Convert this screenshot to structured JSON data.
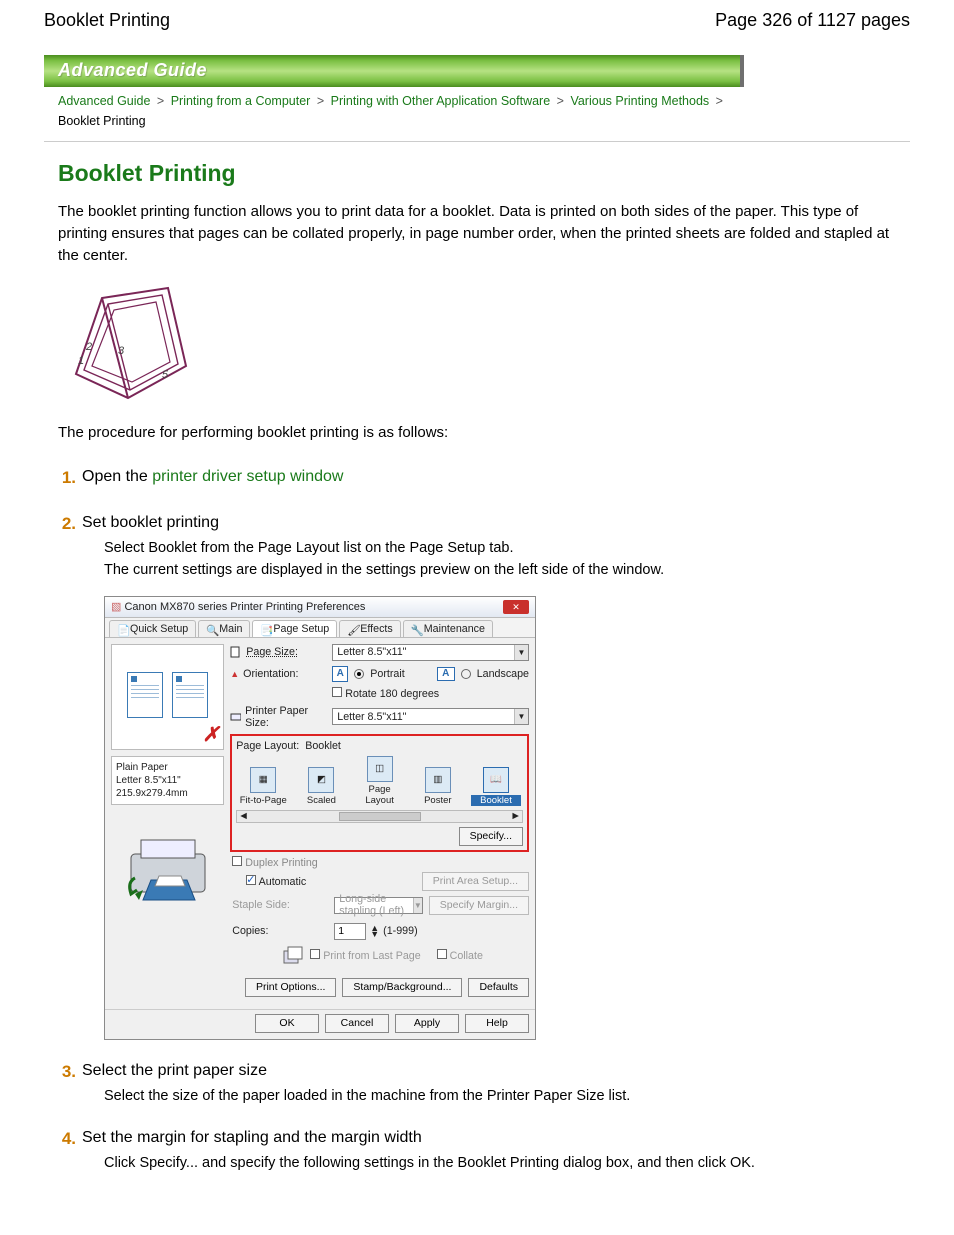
{
  "header": {
    "left": "Booklet Printing",
    "right": "Page 326 of 1127 pages"
  },
  "banner": "Advanced Guide",
  "breadcrumb": {
    "items": [
      {
        "label": "Advanced Guide",
        "link": true
      },
      {
        "label": "Printing from a Computer",
        "link": true
      },
      {
        "label": "Printing with Other Application Software",
        "link": true
      },
      {
        "label": "Various Printing Methods",
        "link": true
      }
    ],
    "last": "Booklet Printing"
  },
  "content": {
    "title": "Booklet Printing",
    "intro": "The booklet printing function allows you to print data for a booklet. Data is printed on both sides of the paper. This type of printing ensures that pages can be collated properly, in page number order, when the printed sheets are folded and stapled at the center.",
    "lead": "The procedure for performing booklet printing is as follows:",
    "steps": [
      {
        "num": "1.",
        "title_pre": "Open the ",
        "title_link": "printer driver setup window"
      },
      {
        "num": "2.",
        "title_pre": "Set booklet printing",
        "body": [
          "Select Booklet from the Page Layout list on the Page Setup tab.",
          "The current settings are displayed in the settings preview on the left side of the window."
        ]
      },
      {
        "num": "3.",
        "title_pre": "Select the print paper size",
        "body": [
          "Select the size of the paper loaded in the machine from the Printer Paper Size list."
        ]
      },
      {
        "num": "4.",
        "title_pre": "Set the margin for stapling and the margin width",
        "body": [
          "Click Specify... and specify the following settings in the Booklet Printing dialog box, and then click OK."
        ]
      }
    ]
  },
  "dialog": {
    "title": "Canon MX870 series Printer Printing Preferences",
    "tabs": [
      "Quick Setup",
      "Main",
      "Page Setup",
      "Effects",
      "Maintenance"
    ],
    "active_tab": "Page Setup",
    "page_size_label": "Page Size:",
    "page_size_value": "Letter 8.5\"x11\"",
    "orientation_label": "Orientation:",
    "orientation_portrait": "Portrait",
    "orientation_landscape": "Landscape",
    "rotate_label": "Rotate 180 degrees",
    "printer_paper_size_label": "Printer Paper Size:",
    "printer_paper_size_value": "Letter 8.5\"x11\"",
    "page_layout_label": "Page Layout:",
    "page_layout_value": "Booklet",
    "layouts": [
      "Fit-to-Page",
      "Scaled",
      "Page Layout",
      "Poster",
      "Booklet"
    ],
    "specify": "Specify...",
    "duplex_label": "Duplex Printing",
    "automatic_label": "Automatic",
    "print_area_setup": "Print Area Setup...",
    "staple_side_label": "Staple Side:",
    "staple_side_value": "Long-side stapling (Left)",
    "specify_margin": "Specify Margin...",
    "copies_label": "Copies:",
    "copies_value": "1",
    "copies_range": "(1-999)",
    "print_from_last": "Print from Last Page",
    "collate": "Collate",
    "print_options": "Print Options...",
    "stamp_background": "Stamp/Background...",
    "defaults": "Defaults",
    "media_line1": "Plain Paper",
    "media_line2": "Letter 8.5\"x11\" 215.9x279.4mm",
    "ok": "OK",
    "cancel": "Cancel",
    "apply": "Apply",
    "help": "Help"
  }
}
